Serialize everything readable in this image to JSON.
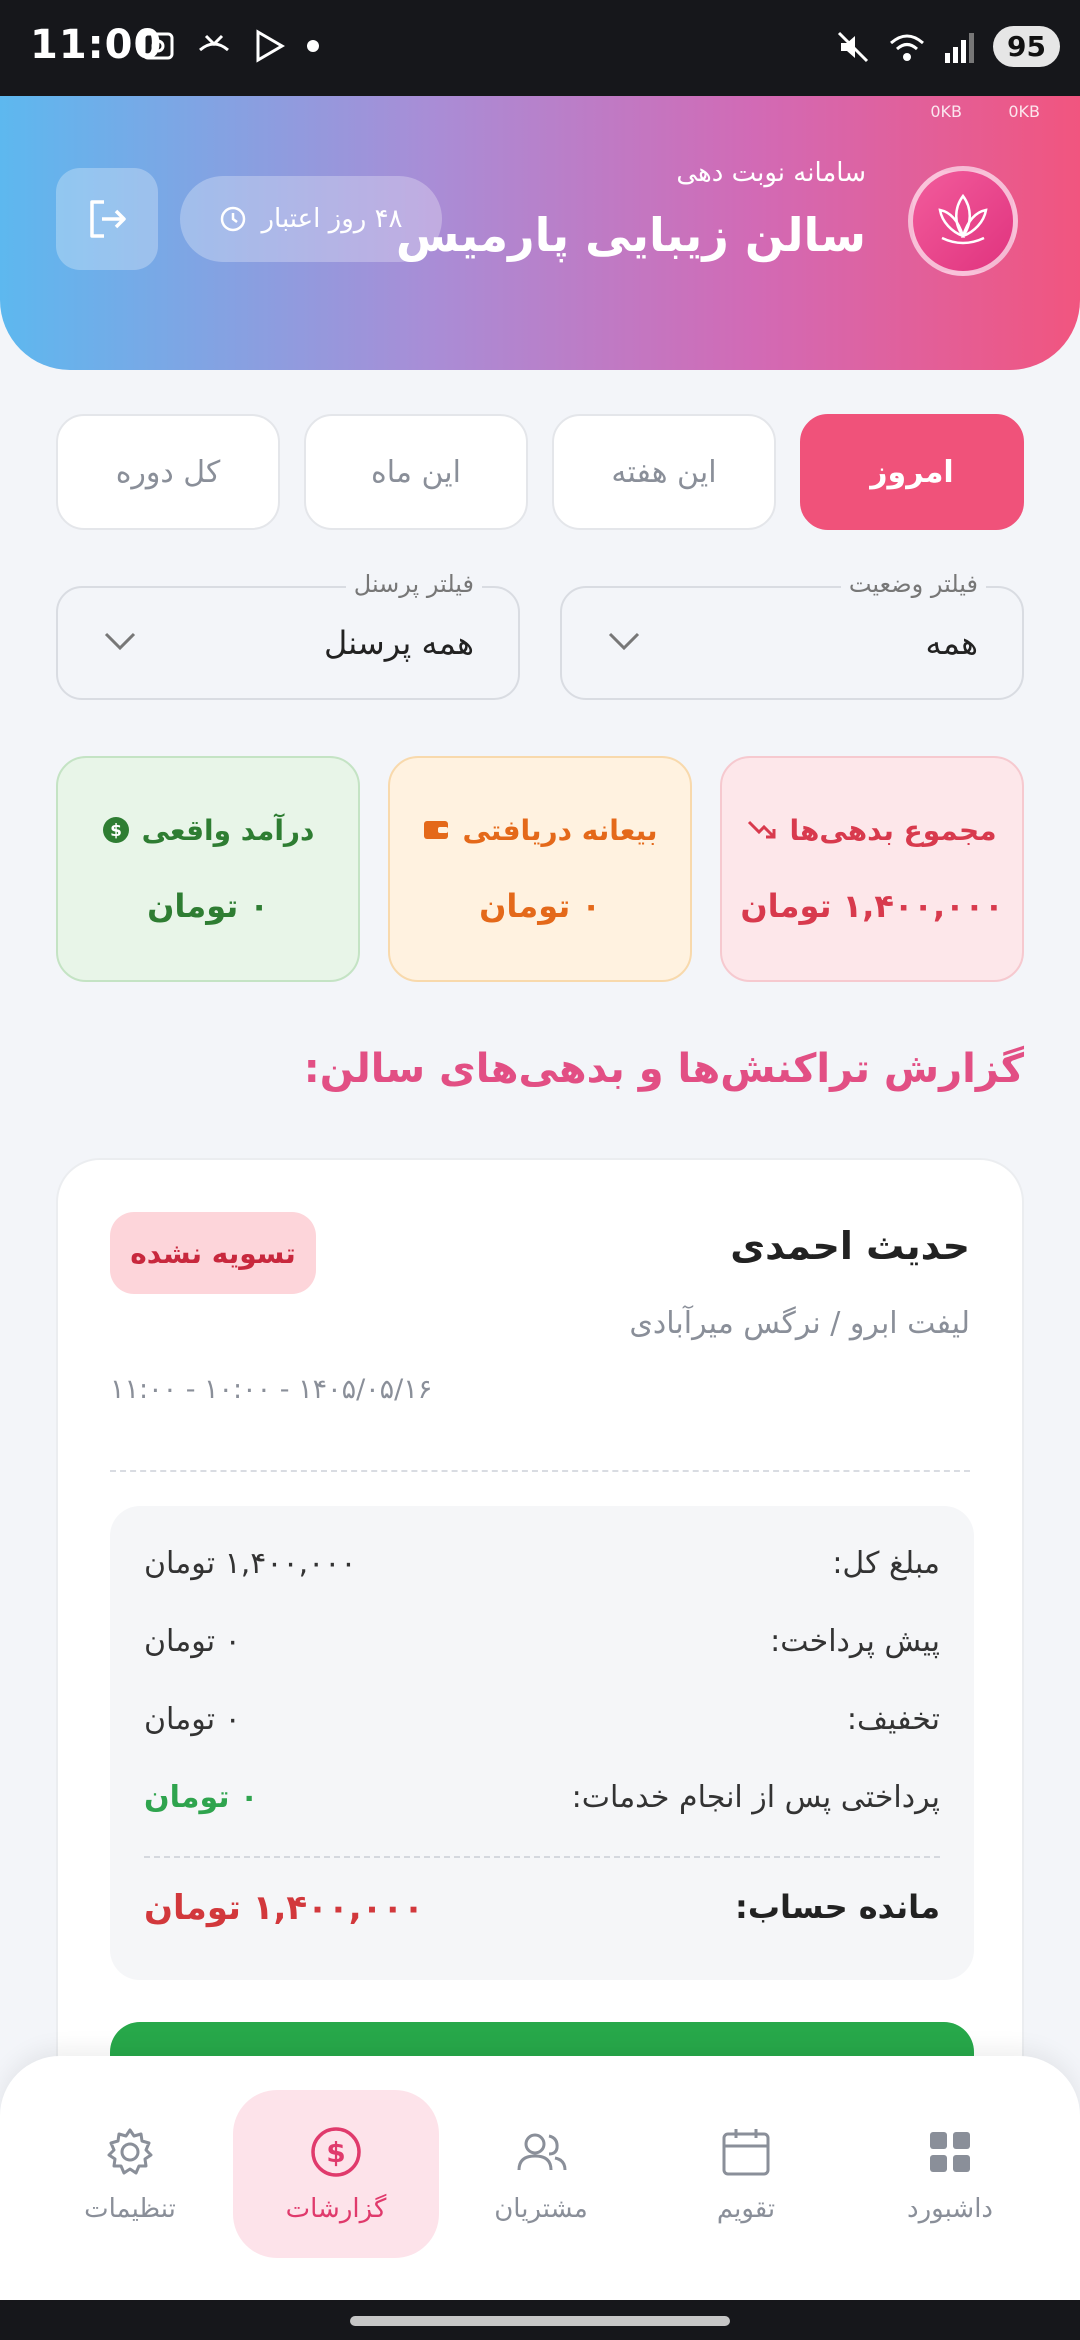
{
  "status_bar": {
    "time": "11:00",
    "battery": "95"
  },
  "header": {
    "subtitle": "سامانه نوبت دهی",
    "title": "سالن زیبایی پارمیس",
    "credit": "۴۸ روز اعتبار",
    "net_left": "0KB",
    "net_right": "0KB"
  },
  "tabs": [
    {
      "label": "امروز",
      "active": true
    },
    {
      "label": "این هفته",
      "active": false
    },
    {
      "label": "این ماه",
      "active": false
    },
    {
      "label": "کل دوره",
      "active": false
    }
  ],
  "filters": {
    "status": {
      "legend": "فیلتر وضعیت",
      "value": "همه"
    },
    "staff": {
      "legend": "فیلتر پرسنل",
      "value": "همه پرسنل"
    }
  },
  "summary": {
    "debts": {
      "label": "مجموع بدهی‌ها",
      "value": "۱,۴۰۰,۰۰۰ تومان"
    },
    "deposit": {
      "label": "بیعانه دریافتی",
      "value": "۰ تومان"
    },
    "income": {
      "label": "درآمد واقعی",
      "value": "۰ تومان"
    }
  },
  "section_title": "گزارش تراکنش‌ها و بدهی‌های سالن:",
  "transaction": {
    "name": "حدیث احمدی",
    "badge": "تسویه نشده",
    "service": "لیفت ابرو / نرگس میرآبادی",
    "datetime": "۱۴۰۵/۰۵/۱۶ - ۱۰:۰۰ - ۱۱:۰۰",
    "rows": {
      "total": {
        "label": "مبلغ کل:",
        "value": "۱,۴۰۰,۰۰۰ تومان"
      },
      "prepay": {
        "label": "پیش پرداخت:",
        "value": "۰ تومان"
      },
      "discount": {
        "label": "تخفیف:",
        "value": "۰ تومان"
      },
      "post_pay": {
        "label": "پرداختی پس از انجام خدمات:",
        "value": "۰ تومان"
      },
      "balance": {
        "label": "مانده حساب:",
        "value": "۱,۴۰۰,۰۰۰ تومان"
      }
    }
  },
  "bottom_nav": {
    "settings": "تنظیمات",
    "reports": "گزارشات",
    "customers": "مشتریان",
    "calendar": "تقویم",
    "dashboard": "داشبورد"
  },
  "colors": {
    "accent": "#f0527a",
    "debt": "#d83a4d",
    "deposit": "#e4691a",
    "income": "#2e7d32",
    "success": "#27a84a"
  }
}
